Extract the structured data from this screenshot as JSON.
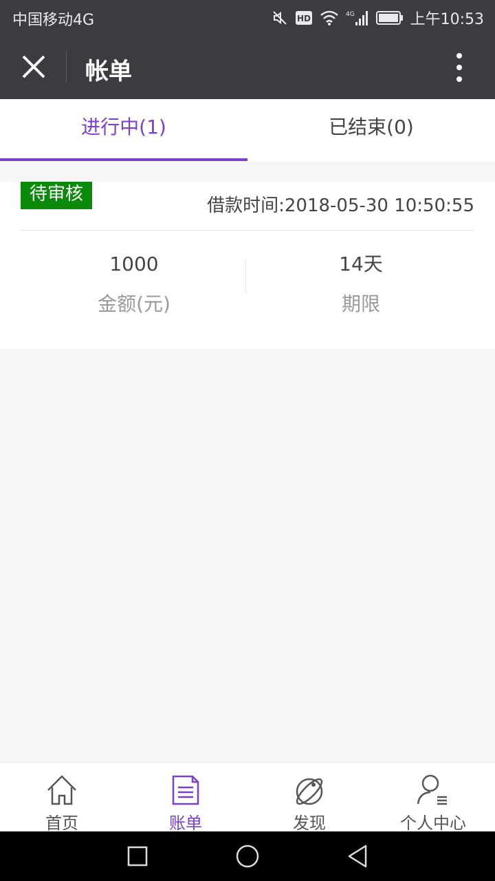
{
  "status_bar": {
    "carrier": "中国移动4G",
    "network": "4G",
    "time": "上午10:53"
  },
  "header": {
    "title": "帐单"
  },
  "tabs": [
    {
      "label": "进行中(1)",
      "active": true
    },
    {
      "label": "已结束(0)",
      "active": false
    }
  ],
  "loan": {
    "status": "待审核",
    "loan_time": "借款时间:2018-05-30 10:50:55",
    "amount_value": "1000",
    "amount_label": "金额(元)",
    "term_value": "14天",
    "term_label": "期限"
  },
  "bottom_nav": [
    {
      "label": "首页",
      "icon": "home-icon"
    },
    {
      "label": "账单",
      "icon": "bill-icon",
      "active": true
    },
    {
      "label": "发现",
      "icon": "planet-icon"
    },
    {
      "label": "个人中心",
      "icon": "user-icon"
    }
  ],
  "colors": {
    "accent": "#7a3fd1",
    "header_bg": "#3b3b40",
    "status_badge": "#0b8a0b"
  }
}
